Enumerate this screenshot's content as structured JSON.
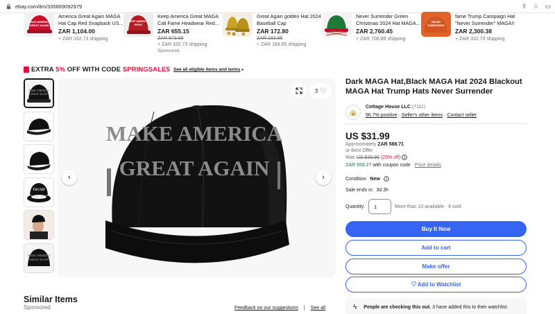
{
  "browser": {
    "url": "ebay.com/itm/335669092979"
  },
  "carousel": [
    {
      "title": "America Great Again MAGA Hat Cap Red Snapback US...",
      "price": "ZAR 1,104.00",
      "strike": "",
      "shipping": "+ ZAR 332.73 shipping",
      "sponsored": "",
      "thumb_color": "#c8102e",
      "thumb_text": "MAKE AMERICA GREAT AGAIN"
    },
    {
      "title": "Keep America Great MAGA Cali Fame Headwear Red...",
      "price": "ZAR 655.15",
      "strike": "ZAR 873.69",
      "shipping": "+ ZAR 332.73 shipping",
      "sponsored": "Sponsored",
      "thumb_color": "#b51b22",
      "thumb_text": "KEEP AMERICA GREAT"
    },
    {
      "title": "Great Again golden Hat 2024 Baseball Cap",
      "price": "ZAR 172.80",
      "strike": "ZAR 183.85",
      "shipping": "+ ZAR 183.85 shipping",
      "sponsored": "",
      "thumb_color": "#c9a227",
      "thumb_text": ""
    },
    {
      "title": "Never Surrender Green Christmas 2024 Hat MAGA...",
      "price": "ZAR 2,760.45",
      "strike": "",
      "shipping": "+ ZAR 708.88 shipping",
      "sponsored": "",
      "thumb_color": "#1f7a3a",
      "thumb_text": ""
    },
    {
      "title": "fame Trump Campaign Hat \"Never Surrender\" MAGA!!",
      "price": "ZAR 2,300.38",
      "strike": "",
      "shipping": "+ ZAR 332.73 shipping",
      "sponsored": "",
      "thumb_color": "#e0642a",
      "thumb_text": "NEVER SURRENDER"
    }
  ],
  "promo": {
    "text_pre": "EXTRA ",
    "percent": "5%",
    "text_mid": " OFF WITH CODE ",
    "code": "SPRINGSALE5",
    "link": "See all eligible items and terms"
  },
  "gallery": {
    "thumbnail_count": 6,
    "watch_count": "3",
    "image_text_line1": "MAKE AMERICA",
    "image_text_line2": "GREAT AGAIN",
    "thumb4_text": "TRUMP"
  },
  "product": {
    "title": "Dark MAGA Hat,Black MAGA Hat 2024 Blackout MAGA Hat Trump Hats Never Surrender"
  },
  "seller": {
    "name": "Cottage House LLC",
    "count": "(7111)",
    "positive": "96.7% positive",
    "other_items": "Seller's other items",
    "contact": "Contact seller"
  },
  "pricing": {
    "price": "US $31.99",
    "approx_label": "Approximately ",
    "approx_value": "ZAR 588.71",
    "best_offer": "or Best Offer",
    "was_label": "Was",
    "was_price": "US $39.99",
    "off": "(20% off)",
    "coupon_price": "ZAR 559.27",
    "coupon_text": " with coupon code",
    "price_details": "Price details"
  },
  "details": {
    "condition_label": "Condition:",
    "condition_value": "New",
    "sale_label": "Sale ends in:",
    "sale_value": "3d 3h",
    "qty_label": "Quantity:",
    "qty_value": "1",
    "availability": "More than 10 available · 9 sold"
  },
  "actions": {
    "buy_now": "Buy It Now",
    "add_to_cart": "Add to cart",
    "make_offer": "Make offer",
    "watchlist": "Add to Watchlist"
  },
  "social_proof": {
    "bold": "People are checking this out.",
    "rest": " 3 have added this to their watchlist."
  },
  "similar": {
    "title": "Similar Items",
    "sponsored": "Sponsored",
    "feedback": "Feedback on our suggestions",
    "separator": "|",
    "see_all": "See all"
  },
  "colors": {
    "ebay_blue": "#3665f3",
    "promo_red": "#e0103a",
    "coupon_green": "#05823f",
    "muted_text": "#707070"
  }
}
